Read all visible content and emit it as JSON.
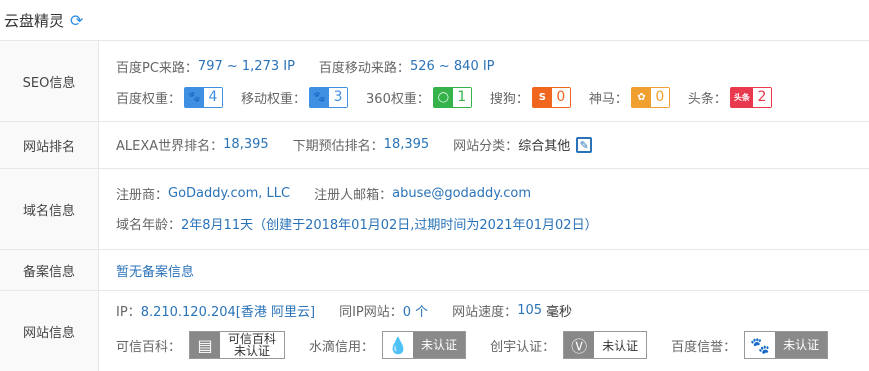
{
  "app": {
    "title": "云盘精灵",
    "refresh_icon": "refresh-icon"
  },
  "seo": {
    "label": "SEO信息",
    "pc_label": "百度PC来路：",
    "pc_value": "797 ~ 1,273 IP",
    "mobile_label": "百度移动来路：",
    "mobile_value": "526 ~ 840 IP",
    "weights": [
      {
        "label": "百度权重：",
        "value": "4",
        "icon": "baidu-paw-icon",
        "color": "#3f8fe3"
      },
      {
        "label": "移动权重：",
        "value": "3",
        "icon": "baidu-paw-icon",
        "color": "#3f8fe3"
      },
      {
        "label": "360权重：",
        "value": "1",
        "icon": "360-icon",
        "color": "#35b34a"
      },
      {
        "label": "搜狗：",
        "value": "0",
        "icon": "sogou-icon",
        "color": "#f0661f"
      },
      {
        "label": "神马：",
        "value": "0",
        "icon": "shenma-icon",
        "color": "#f0a030"
      },
      {
        "label": "头条：",
        "value": "2",
        "icon": "toutiao-icon",
        "color": "#e8394e",
        "icon_text": "头条"
      }
    ]
  },
  "rank": {
    "label": "网站排名",
    "alexa_label": "ALEXA世界排名：",
    "alexa_value": "18,395",
    "next_label": "下期预估排名：",
    "next_value": "18,395",
    "category_label": "网站分类：",
    "category_value": "综合其他"
  },
  "domain": {
    "label": "域名信息",
    "registrar_label": "注册商：",
    "registrar_value": "GoDaddy.com, LLC",
    "email_label": "注册人邮箱：",
    "email_value": "abuse@godaddy.com",
    "age_label": "域名年龄：",
    "age_value": "2年8月11天（创建于2018年01月02日,过期时间为2021年01月02日）"
  },
  "icp": {
    "label": "备案信息",
    "value": "暂无备案信息"
  },
  "site": {
    "label": "网站信息",
    "ip_label": "IP：",
    "ip_value": "8.210.120.204[香港 阿里云]",
    "same_ip_label": "同IP网站：",
    "same_ip_value": "0 个",
    "speed_label": "网站速度：",
    "speed_value": "105",
    "speed_unit": "毫秒",
    "certs": [
      {
        "label": "可信百科：",
        "badge_line1": "可信百科",
        "badge_line2": "未认证"
      },
      {
        "label": "水滴信用：",
        "badge": "未认证"
      },
      {
        "label": "创宇认证：",
        "badge": "未认证"
      },
      {
        "label": "百度信誉：",
        "badge": "未认证"
      }
    ]
  }
}
